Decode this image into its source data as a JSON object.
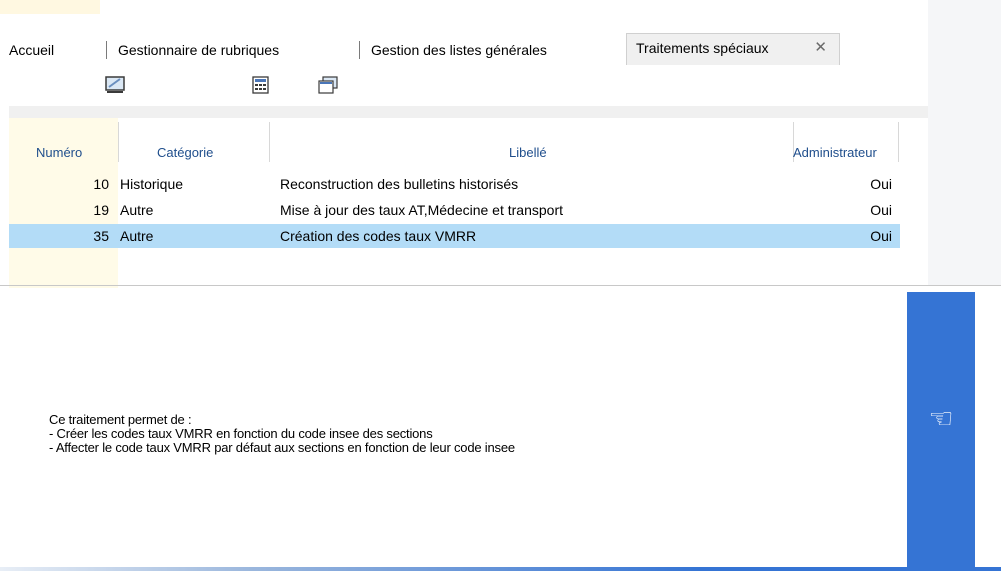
{
  "tabs": {
    "accueil": "Accueil",
    "rubriques": "Gestionnaire de rubriques",
    "listes": "Gestion des listes générales",
    "active": "Traitements spéciaux",
    "close": "✕"
  },
  "toolbar": {
    "buttons": [
      "monitor-icon",
      "calculator-icon",
      "window-icon"
    ]
  },
  "grid": {
    "columns": {
      "numero": "Numéro",
      "categorie": "Catégorie",
      "libelle": "Libellé",
      "administrateur": "Administrateur"
    },
    "rows": [
      {
        "numero": "10",
        "categorie": "Historique",
        "libelle": "Reconstruction des bulletins historisés",
        "administrateur": "Oui"
      },
      {
        "numero": "19",
        "categorie": "Autre",
        "libelle": "Mise à jour des taux AT,Médecine et transport",
        "administrateur": "Oui"
      },
      {
        "numero": "35",
        "categorie": "Autre",
        "libelle": "Création des codes taux VMRR",
        "administrateur": "Oui"
      }
    ],
    "selected_row": 2
  },
  "description": {
    "lines": [
      "Ce traitement permet de :",
      "- Créer les codes taux VMRR en fonction du code insee des sections",
      "- Affecter le code taux VMRR par défaut aux sections en fonction de leur code insee"
    ]
  },
  "action": {
    "icon": "☜",
    "icon_name": "pointing-hand-icon"
  },
  "colors": {
    "accent": "#3574d4",
    "selection": "#b3dcf7",
    "header_text": "#1f4e8c"
  }
}
